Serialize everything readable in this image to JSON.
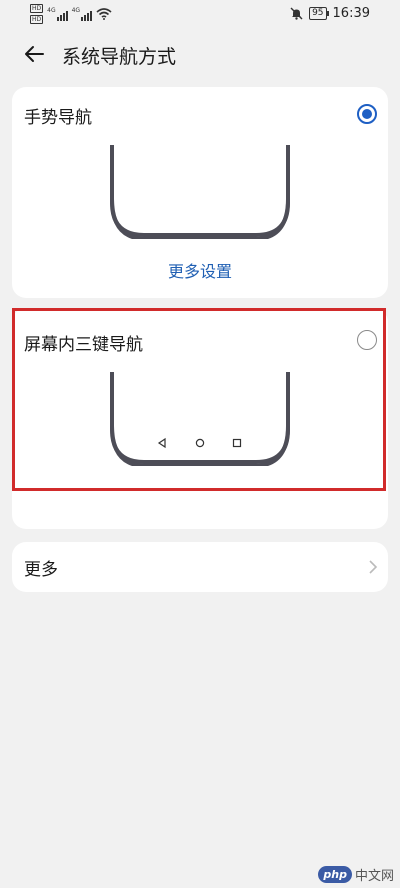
{
  "status_bar": {
    "sim_labels": [
      "HD",
      "HD"
    ],
    "signal_labels": [
      "4G",
      "4G"
    ],
    "time": "16:39",
    "battery": "95"
  },
  "header": {
    "title": "系统导航方式"
  },
  "options": [
    {
      "label": "手势导航",
      "selected": true,
      "action_label": "更多设置"
    },
    {
      "label": "屏幕内三键导航",
      "selected": false
    }
  ],
  "more_row": {
    "label": "更多"
  },
  "watermark": {
    "logo": "php",
    "text": "中文网"
  },
  "colors": {
    "accent": "#1e5fc4",
    "link": "#1f5fb3",
    "highlight": "#d12b2b",
    "phone_frame": "#4d4d57",
    "background": "#f1f1f1"
  },
  "icons": {
    "back": "arrow-left-icon",
    "silent": "bell-off-icon",
    "wifi": "wifi-icon",
    "nav_back": "triangle-back-icon",
    "nav_home": "circle-home-icon",
    "nav_recent": "square-recent-icon",
    "chevron": "chevron-right-icon"
  }
}
